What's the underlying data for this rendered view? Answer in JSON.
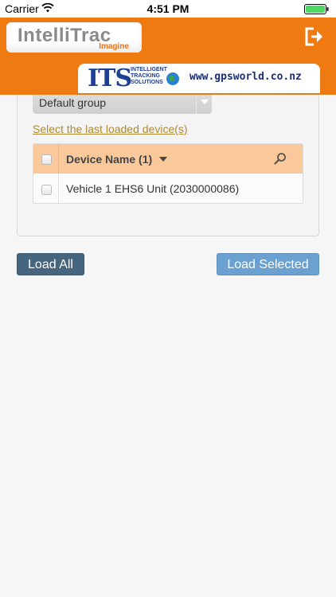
{
  "status_bar": {
    "carrier": "Carrier",
    "time": "4:51 PM",
    "battery_color": "#4cd964"
  },
  "header": {
    "background": "#f07a12",
    "logo": {
      "main": "IntelliTrac",
      "sub": "Imagine"
    },
    "logout_icon": "logout-icon",
    "sponsor": {
      "letters": "ITS",
      "text_line1": "INTELLIGENT",
      "text_line2": "TRACKING",
      "text_line3": "SOLUTIONS",
      "url": "www.gpsworld.co.nz"
    }
  },
  "panel": {
    "group_select": {
      "value": "Default group"
    },
    "last_loaded_link": "Select the last loaded device(s)",
    "table": {
      "columns": [
        {
          "label": "Device Name (1)"
        }
      ],
      "rows": [
        {
          "name": "Vehicle 1 EHS6 Unit (2030000086)",
          "checked": false
        }
      ]
    }
  },
  "actions": {
    "load_all": "Load All",
    "load_selected": "Load Selected"
  }
}
